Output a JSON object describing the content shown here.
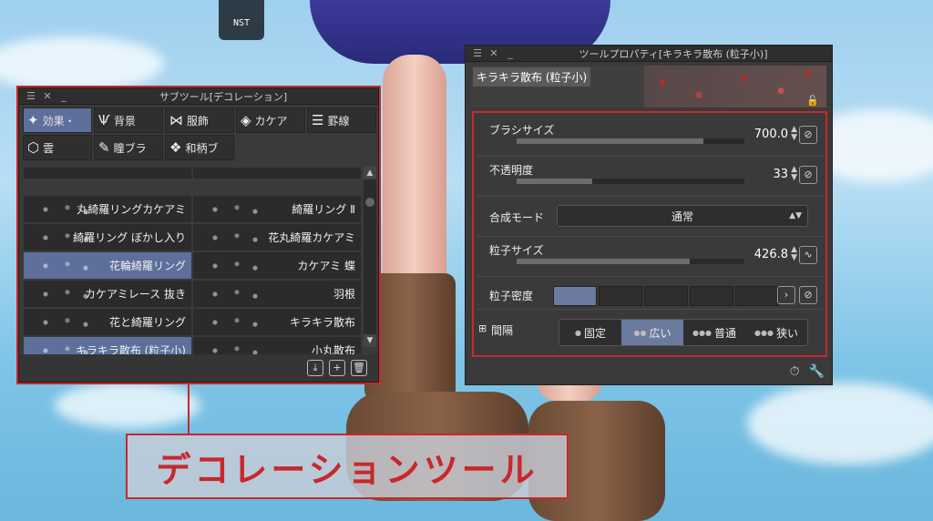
{
  "background": {
    "can_label": "NST"
  },
  "subtool": {
    "title": "サブツール[デコレーション]",
    "tabs": [
      {
        "icon": "sparkle-icon",
        "label": "効果・",
        "active": true
      },
      {
        "icon": "grass-icon",
        "label": "背景",
        "active": false
      },
      {
        "icon": "ribbon-icon",
        "label": "服飾",
        "active": false
      },
      {
        "icon": "lattice-icon",
        "label": "カケア",
        "active": false
      },
      {
        "icon": "lines-icon",
        "label": "罫線",
        "active": false
      },
      {
        "icon": "cloud-icon",
        "label": "雲",
        "active": false
      },
      {
        "icon": "brush-icon",
        "label": "瞳ブラ",
        "active": false
      },
      {
        "icon": "pattern-icon",
        "label": "和柄ブ",
        "active": false
      }
    ],
    "items": [
      {
        "label": "丸綺羅リングカケアミ",
        "selected": false
      },
      {
        "label": "綺羅リング Ⅱ",
        "selected": false
      },
      {
        "label": "綺羅リング ぼかし入り",
        "selected": false
      },
      {
        "label": "花丸綺羅カケアミ",
        "selected": false
      },
      {
        "label": "花輪綺羅リング",
        "selected": true
      },
      {
        "label": "カケアミ 蝶",
        "selected": false
      },
      {
        "label": "カケアミレース 抜き",
        "selected": false
      },
      {
        "label": "羽根",
        "selected": false
      },
      {
        "label": "花と綺羅リング",
        "selected": false
      },
      {
        "label": "キラキラ散布",
        "selected": false
      },
      {
        "label": "キラキラ散布 (粒子小)",
        "selected": true
      },
      {
        "label": "小丸散布",
        "selected": false
      }
    ]
  },
  "caption": "デコレーションツール",
  "toolprop": {
    "title": "ツールプロパティ[キラキラ散布 (粒子小)]",
    "preview_name": "キラキラ散布 (粒子小)",
    "brush_size": {
      "label": "ブラシサイズ",
      "value": "700.0",
      "fill": 0.82
    },
    "opacity": {
      "label": "不透明度",
      "value": "33",
      "fill": 0.33
    },
    "blend_mode": {
      "label": "合成モード",
      "value": "通常"
    },
    "particle_size": {
      "label": "粒子サイズ",
      "value": "426.8",
      "fill": 0.76
    },
    "particle_density": {
      "label": "粒子密度",
      "segments": 5,
      "active": 1
    },
    "interval": {
      "label": "間隔",
      "options": [
        {
          "label": "固定",
          "active": false
        },
        {
          "label": "広い",
          "active": true
        },
        {
          "label": "普通",
          "active": false
        },
        {
          "label": "狭い",
          "active": false
        }
      ]
    }
  }
}
